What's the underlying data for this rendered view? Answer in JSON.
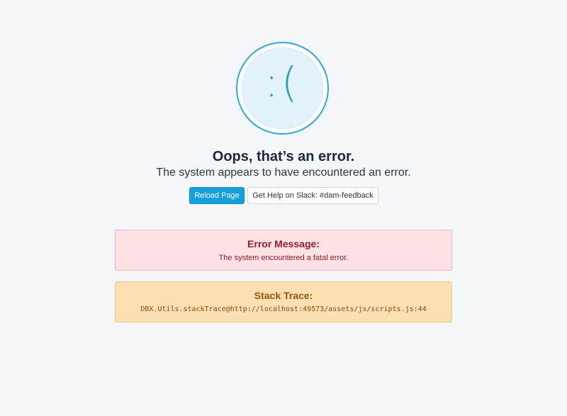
{
  "face": {
    "glyph": ":("
  },
  "headline": "Oops, that’s an error.",
  "subline": "The system appears to have encountered an error.",
  "buttons": {
    "reload_label": "Reload Page",
    "slack_label": "Get Help on Slack: #dam-feedback"
  },
  "error_message": {
    "title": "Error Message:",
    "text": "The system encountered a fatal error."
  },
  "stack_trace": {
    "title": "Stack Trace:",
    "text": "DBX.Utils.stackTrace@http://localhost:49573/assets/js/scripts.js:44"
  },
  "colors": {
    "background": "#f4f7fa",
    "accent": "#14a0dc",
    "error_bg": "#fde1e4",
    "error_text": "#9b1c25",
    "warning_bg": "#fde0b2",
    "warning_text": "#a0520c"
  }
}
